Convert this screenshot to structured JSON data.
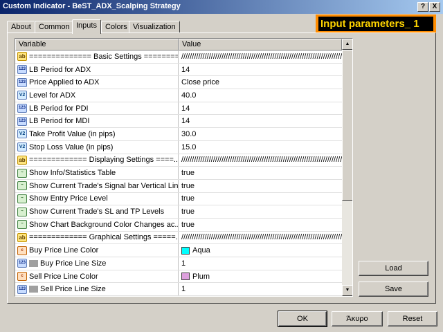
{
  "window": {
    "title": "Custom Indicator - BeST_ADX_Scalping Strategy",
    "help_label": "?",
    "close_label": "X"
  },
  "tabs": [
    {
      "label": "About"
    },
    {
      "label": "Common"
    },
    {
      "label": "Inputs"
    },
    {
      "label": "Colors"
    },
    {
      "label": "Visualization"
    }
  ],
  "badge": "Input parameters_ 1",
  "grid": {
    "header_variable": "Variable",
    "header_value": "Value",
    "rows": [
      {
        "icon": "ab",
        "icon_text": "ab",
        "variable": "============== Basic Settings =========...",
        "value": "//////////////////////////////////////////////////////////////////////////////////"
      },
      {
        "icon": "num",
        "icon_text": "123",
        "variable": "LB Period for ADX",
        "value": "14"
      },
      {
        "icon": "num",
        "icon_text": "123",
        "variable": "Price Applied to ADX",
        "value": "Close price"
      },
      {
        "icon": "val",
        "icon_text": "V2",
        "variable": "Level for ADX",
        "value": "40.0"
      },
      {
        "icon": "num",
        "icon_text": "123",
        "variable": "LB Period for PDI",
        "value": "14"
      },
      {
        "icon": "num",
        "icon_text": "123",
        "variable": "LB Period for MDI",
        "value": "14"
      },
      {
        "icon": "val",
        "icon_text": "V2",
        "variable": "Take Profit Value (in pips)",
        "value": "30.0"
      },
      {
        "icon": "val",
        "icon_text": "V2",
        "variable": "Stop Loss Value (in pips)",
        "value": "15.0"
      },
      {
        "icon": "ab",
        "icon_text": "ab",
        "variable": "============= Displaying Settings ====...",
        "value": "//////////////////////////////////////////////////////////////////////////////////"
      },
      {
        "icon": "bool",
        "icon_text": "~",
        "variable": "Show Info/Statistics Table",
        "value": "true"
      },
      {
        "icon": "bool",
        "icon_text": "~",
        "variable": "Show Current Trade's Signal bar Vertical Line",
        "value": "true"
      },
      {
        "icon": "bool",
        "icon_text": "~",
        "variable": "Show Entry Price Level",
        "value": "true"
      },
      {
        "icon": "bool",
        "icon_text": "~",
        "variable": "Show Current Trade's SL and TP Levels",
        "value": "true"
      },
      {
        "icon": "bool",
        "icon_text": "~",
        "variable": "Show Chart Background Color Changes ac...",
        "value": "true"
      },
      {
        "icon": "ab",
        "icon_text": "ab",
        "variable": "============= Graphical Settings =====...",
        "value": "//////////////////////////////////////////////////////////////////////////////////"
      },
      {
        "icon": "col",
        "icon_text": "c",
        "variable": "Buy Price Line Color",
        "value": "Aqua",
        "swatch": "#00ffff"
      },
      {
        "icon": "num",
        "icon_text": "123",
        "variable": "Buy Price Line Size",
        "value": "1",
        "sub": true
      },
      {
        "icon": "col",
        "icon_text": "c",
        "variable": "Sell Price Line Color",
        "value": "Plum",
        "swatch": "#dda0dd"
      },
      {
        "icon": "num",
        "icon_text": "123",
        "variable": "Sell Price Line Size",
        "value": "1",
        "sub": true
      }
    ]
  },
  "buttons": {
    "load": "Load",
    "save": "Save",
    "ok": "OK",
    "cancel": "Άκυρο",
    "reset": "Reset"
  },
  "colors": {
    "title_start": "#0a246a",
    "title_end": "#a6caf0",
    "badge_border": "#ff8c00",
    "badge_text": "#ffd400"
  }
}
